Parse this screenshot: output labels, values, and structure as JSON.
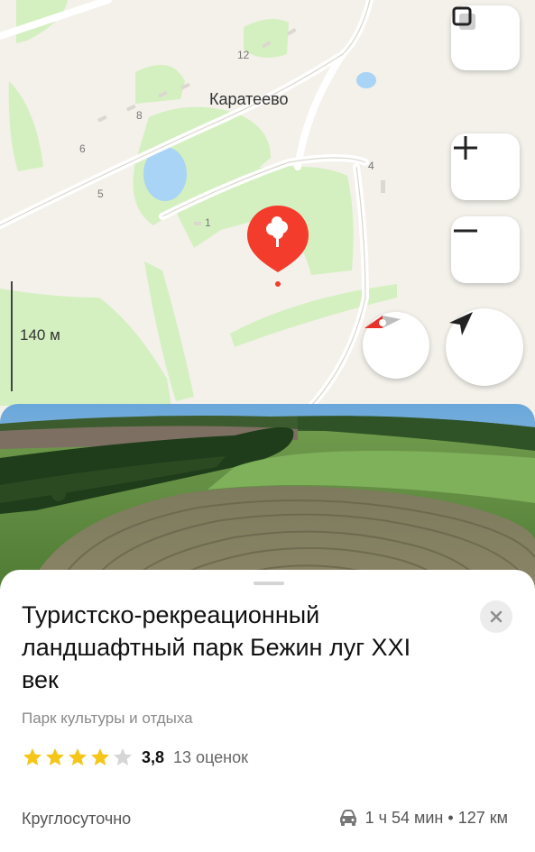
{
  "map": {
    "village_name": "Каратеево",
    "house_numbers": [
      "12",
      "8",
      "6",
      "5",
      "4",
      "1"
    ],
    "scale_label": "140 м",
    "controls": {
      "layers_icon": "layers-icon",
      "zoom_in_icon": "plus-icon",
      "zoom_out_icon": "minus-icon",
      "compass_icon": "compass-icon",
      "locate_icon": "navigation-arrow-icon"
    },
    "pin_icon": "tree-icon",
    "colors": {
      "pin": "#f43c2c",
      "park": "#d4f0c0",
      "water": "#a9d4f5"
    }
  },
  "place": {
    "title": "Туристско-рекреационный ландшафтный парк Бежин луг XXI век",
    "category": "Парк культуры и отдыха",
    "rating": {
      "value": "3,8",
      "count": "13 оценок",
      "stars_filled": 4,
      "stars_total": 5,
      "star_color": "#f5c518"
    },
    "hours": "Круглосуточно",
    "route": {
      "icon": "car-icon",
      "time": "1 ч 54 мин",
      "separator": "•",
      "distance": "127 км"
    },
    "close_icon": "close-icon"
  }
}
